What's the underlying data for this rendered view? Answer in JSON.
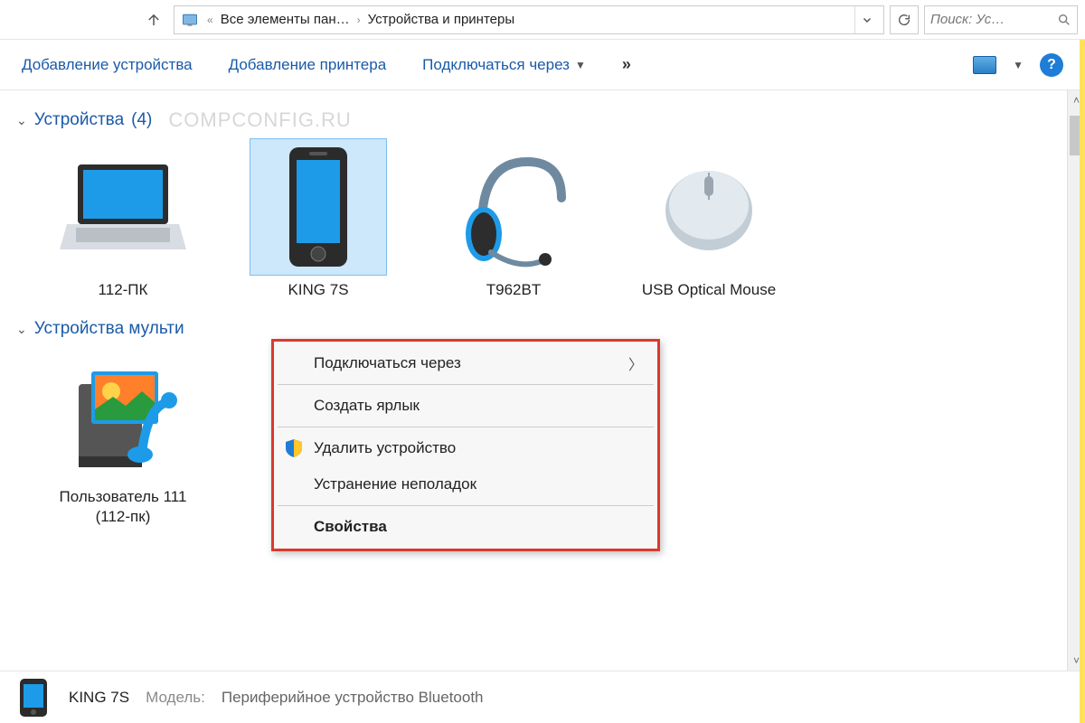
{
  "address": {
    "back_ellipsis": "«",
    "crumb1": "Все элементы пан…",
    "crumb2": "Устройства и принтеры"
  },
  "search": {
    "placeholder": "Поиск: Ус…"
  },
  "toolbar": {
    "add_device": "Добавление устройства",
    "add_printer": "Добавление принтера",
    "connect_via": "Подключаться через",
    "overflow": "»"
  },
  "sections": {
    "devices": {
      "title": "Устройства",
      "count": "(4)"
    },
    "multimedia": {
      "title": "Устройства мульти"
    }
  },
  "watermark": "COMPCONFIG.RU",
  "devices": [
    {
      "label": "112-ПК"
    },
    {
      "label": "KING 7S"
    },
    {
      "label": "T962BT"
    },
    {
      "label": "USB Optical Mouse"
    }
  ],
  "multimedia": [
    {
      "label": "Пользователь 111 (112-пк)"
    }
  ],
  "context_menu": {
    "connect_via": "Подключаться через",
    "create_shortcut": "Создать ярлык",
    "remove_device": "Удалить устройство",
    "troubleshoot": "Устранение неполадок",
    "properties": "Свойства"
  },
  "details": {
    "name": "KING 7S",
    "model_label": "Модель:",
    "model_value": "Периферийное устройство Bluetooth"
  }
}
